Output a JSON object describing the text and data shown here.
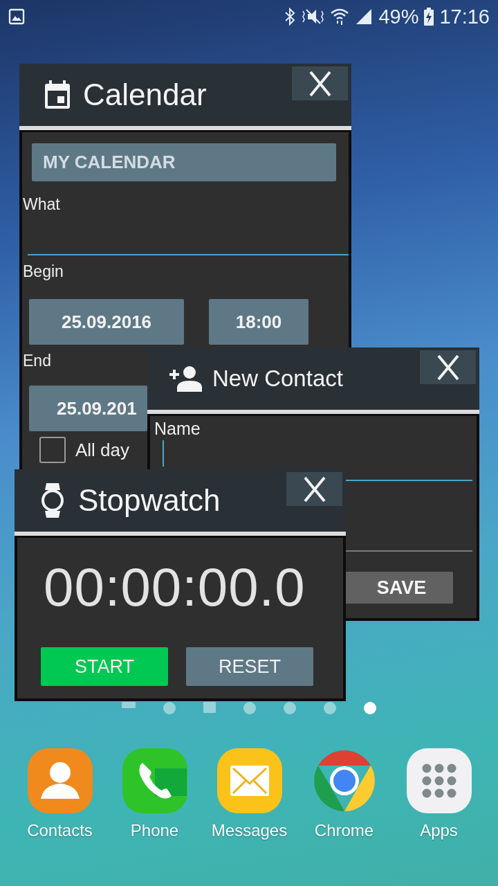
{
  "status_bar": {
    "battery": "49%",
    "time": "17:16"
  },
  "calendar_window": {
    "title": "Calendar",
    "calendar_selector": "MY CALENDAR",
    "what_label": "What",
    "begin_label": "Begin",
    "begin_date": "25.09.2016",
    "begin_time": "18:00",
    "end_label": "End",
    "end_date": "25.09.201",
    "all_day": {
      "label": "All day",
      "checked": false
    }
  },
  "contact_window": {
    "title": "New Contact",
    "name_label": "Name",
    "save_button": "SAVE"
  },
  "stopwatch_window": {
    "title": "Stopwatch",
    "time": "00:00:00.0",
    "buttons": [
      {
        "label": "START",
        "kind": "start"
      },
      {
        "label": "RESET",
        "kind": "reset"
      }
    ]
  },
  "page_indicators": [
    {
      "kind": "bar",
      "selected": false
    },
    {
      "kind": "dot",
      "selected": false
    },
    {
      "kind": "home",
      "selected": false
    },
    {
      "kind": "dot",
      "selected": false
    },
    {
      "kind": "dot",
      "selected": false
    },
    {
      "kind": "dot",
      "selected": false
    },
    {
      "kind": "dot",
      "selected": true
    }
  ],
  "dock": [
    {
      "label": "Contacts",
      "kind": "contacts"
    },
    {
      "label": "Phone",
      "kind": "phone"
    },
    {
      "label": "Messages",
      "kind": "messages"
    },
    {
      "label": "Chrome",
      "kind": "browser"
    },
    {
      "label": "Apps",
      "kind": "apps"
    }
  ]
}
